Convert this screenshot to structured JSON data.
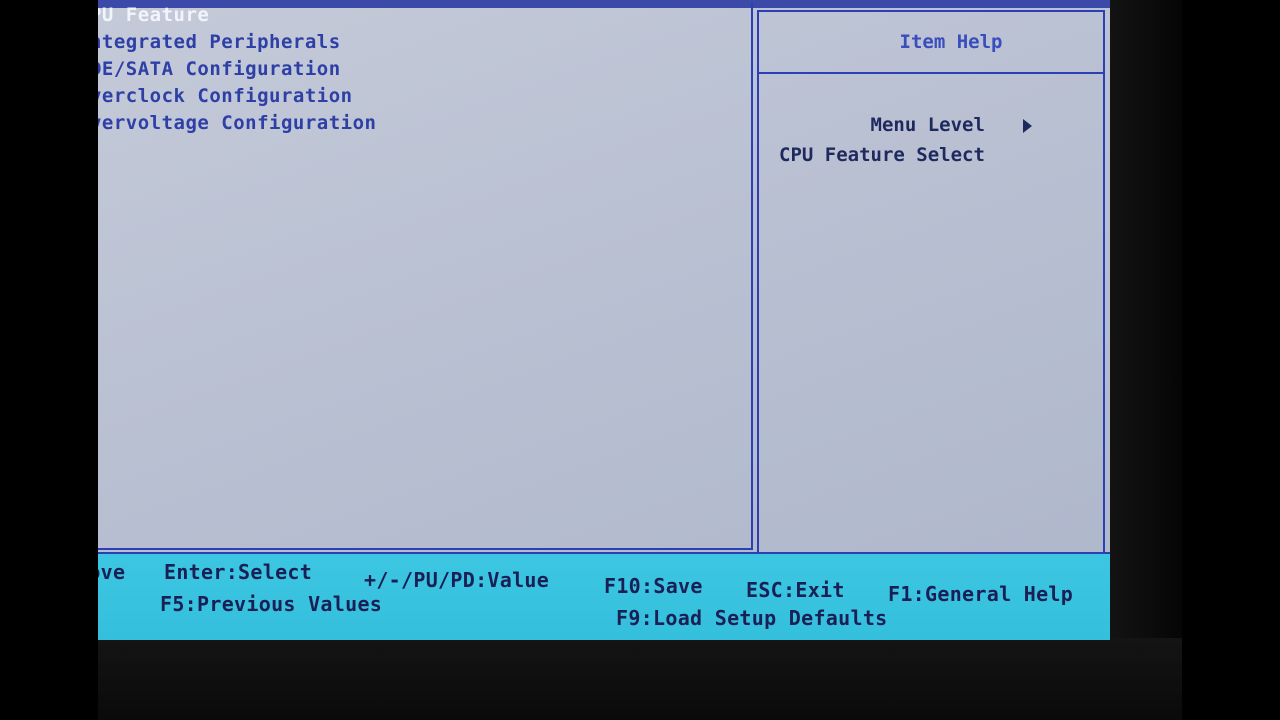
{
  "menu": {
    "items": [
      {
        "label": "CPU Feature",
        "selected": true
      },
      {
        "label": "Integrated Peripherals",
        "selected": false
      },
      {
        "label": "IDE/SATA Configuration",
        "selected": false
      },
      {
        "label": "Overclock Configuration",
        "selected": false
      },
      {
        "label": "Overvoltage Configuration",
        "selected": false
      }
    ]
  },
  "help": {
    "title": "Item Help",
    "menu_level_label": "Menu Level",
    "description": "CPU Feature Select"
  },
  "footer": {
    "row1": {
      "move": "Move",
      "enter": "Enter:Select",
      "value": "+/-/PU/PD:Value",
      "save": "F10:Save",
      "exit": "ESC:Exit",
      "help": "F1:General Help"
    },
    "row2": {
      "previous": "F5:Previous Values",
      "defaults": "F9:Load Setup Defaults"
    }
  },
  "colors": {
    "screen_bg": "#bcc3d4",
    "border": "#2c3fb4",
    "menu_text": "#2e3fa6",
    "selected_text": "#f2f4fb",
    "footer_bg": "#3cc6e2",
    "footer_text": "#1a1f55"
  }
}
